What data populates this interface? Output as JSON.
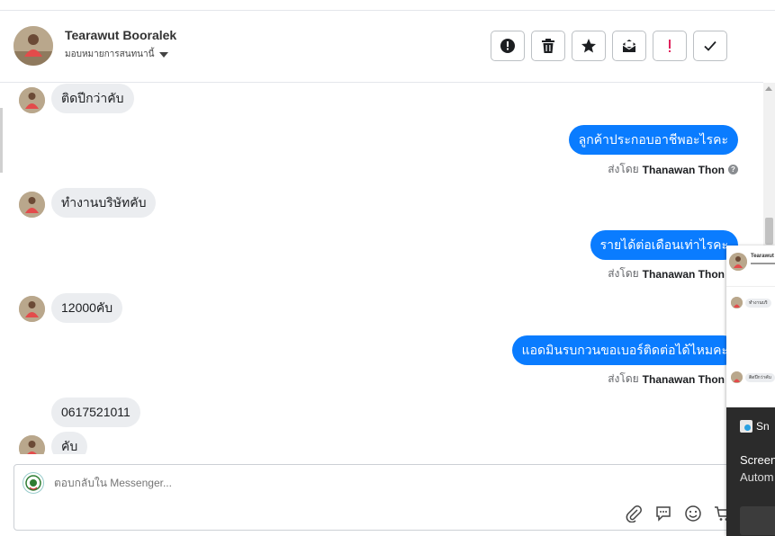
{
  "header": {
    "contact_name": "Tearawut Booralek",
    "assign_label": "มอบหมายการสนทนานี้"
  },
  "actions": [
    {
      "name": "spam-button",
      "icon": "alert-circle-icon"
    },
    {
      "name": "delete-button",
      "icon": "trash-icon"
    },
    {
      "name": "star-button",
      "icon": "star-icon"
    },
    {
      "name": "mark-unread-button",
      "icon": "envelope-icon"
    },
    {
      "name": "follow-up-button",
      "icon": "exclamation-icon",
      "color": "#e0245e"
    },
    {
      "name": "done-button",
      "icon": "check-icon"
    }
  ],
  "messages": [
    {
      "dir": "in",
      "text": "ติดปีกว่าคับ"
    },
    {
      "dir": "out",
      "text": "ลูกค้าประกอบอาชีพอะไรคะ",
      "sent_by_label": "ส่งโดย",
      "sender": "Thanawan Thon"
    },
    {
      "dir": "in",
      "text": "ทำงานบริษัทคับ"
    },
    {
      "dir": "out",
      "text": "รายได้ต่อเดือนเท่าไรคะ",
      "sent_by_label": "ส่งโดย",
      "sender": "Thanawan Thon"
    },
    {
      "dir": "in",
      "text": "12000คับ"
    },
    {
      "dir": "out",
      "text": "แอดมินรบกวนขอเบอร์ติดต่อได้ไหมคะ",
      "sent_by_label": "ส่งโดย",
      "sender": "Thanawan Thon"
    },
    {
      "dir": "in",
      "text": "0617521011"
    },
    {
      "dir": "in",
      "text": "คับ"
    }
  ],
  "reply": {
    "placeholder": "ตอบกลับใน Messenger..."
  },
  "overlay": {
    "contact_name": "Tearawut",
    "bubble_1": "ทำงานบริ",
    "bubble_2": "ติดปีกว่าคับ",
    "app_name": "Sn",
    "title_line": "Screen",
    "body_line": "Autom"
  },
  "colors": {
    "accent": "#0a7cff",
    "incoming_bubble": "#ebedf0",
    "follow_up": "#e0245e"
  }
}
